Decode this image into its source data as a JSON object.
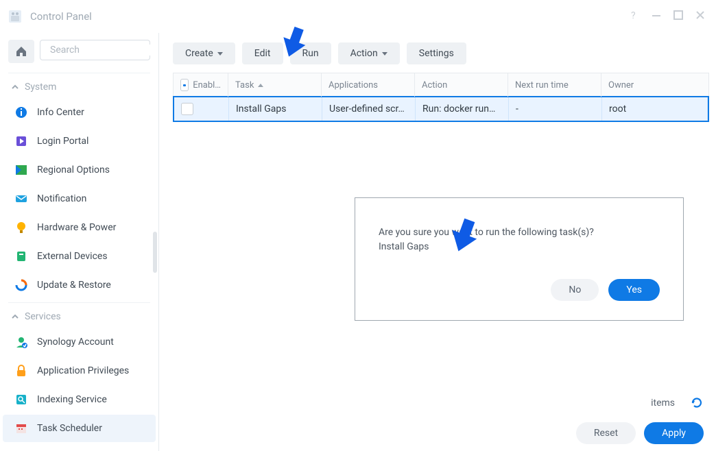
{
  "window": {
    "title": "Control Panel"
  },
  "search": {
    "placeholder": "Search"
  },
  "sections": {
    "system": "System",
    "services": "Services"
  },
  "nav": {
    "info_center": "Info Center",
    "login_portal": "Login Portal",
    "regional_options": "Regional Options",
    "notification": "Notification",
    "hardware_power": "Hardware & Power",
    "external_devices": "External Devices",
    "update_restore": "Update & Restore",
    "synology_account": "Synology Account",
    "application_privileges": "Application Privileges",
    "indexing_service": "Indexing Service",
    "task_scheduler": "Task Scheduler"
  },
  "toolbar": {
    "create": "Create",
    "edit": "Edit",
    "run": "Run",
    "action": "Action",
    "settings": "Settings"
  },
  "columns": {
    "enabled": "Enabl…",
    "task": "Task",
    "applications": "Applications",
    "action": "Action",
    "next_run": "Next run time",
    "owner": "Owner"
  },
  "rows": [
    {
      "task": "Install Gaps",
      "applications": "User-defined scr…",
      "action": "Run: docker run…",
      "next_run": "-",
      "owner": "root"
    }
  ],
  "dialog": {
    "line1": "Are you sure you want to run the following task(s)?",
    "line2": "Install Gaps",
    "no": "No",
    "yes": "Yes"
  },
  "footer": {
    "items": "items",
    "reset": "Reset",
    "apply": "Apply"
  }
}
